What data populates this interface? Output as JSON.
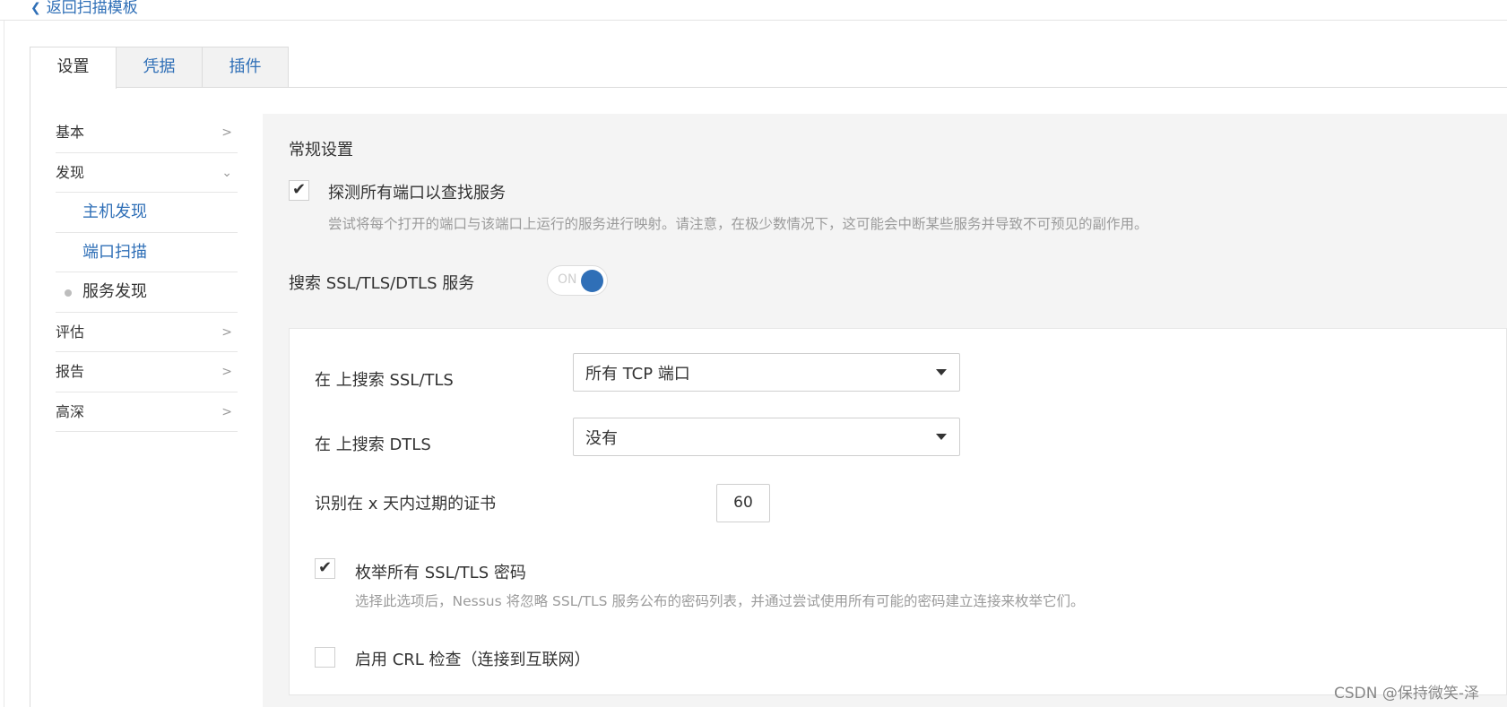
{
  "header": {
    "back_label": "返回扫描模板"
  },
  "tabs": [
    {
      "label": "设置"
    },
    {
      "label": "凭据"
    },
    {
      "label": "插件"
    }
  ],
  "sidebar": {
    "items": [
      {
        "label": "基本"
      },
      {
        "label": "发现"
      },
      {
        "label": "主机发现"
      },
      {
        "label": "端口扫描"
      },
      {
        "label": "服务发现"
      },
      {
        "label": "评估"
      },
      {
        "label": "报告"
      },
      {
        "label": "高深"
      }
    ]
  },
  "main": {
    "section_title": "常规设置",
    "probe_all_ports": {
      "label": "探测所有端口以查找服务",
      "description": "尝试将每个打开的端口与该端口上运行的服务进行映射。请注意，在极少数情况下，这可能会中断某些服务并导致不可预见的副作用。",
      "checked": true
    },
    "ssl_search": {
      "label": "搜索 SSL/TLS/DTLS 服务",
      "toggle_text": "ON"
    },
    "ssl_tls_on": {
      "label": "在 上搜索 SSL/TLS",
      "value": "所有 TCP 端口"
    },
    "dtls_on": {
      "label": "在 上搜索 DTLS",
      "value": "没有"
    },
    "cert_expiry": {
      "label": "识别在 x 天内过期的证书",
      "value": "60"
    },
    "enum_ciphers": {
      "label": "枚举所有 SSL/TLS 密码",
      "description": "选择此选项后，Nessus 将忽略 SSL/TLS 服务公布的密码列表，并通过尝试使用所有可能的密码建立连接来枚举它们。",
      "checked": true
    },
    "crl_check": {
      "label": "启用 CRL 检查（连接到互联网）",
      "checked": false
    }
  },
  "watermark": "CSDN @保持微笑-泽"
}
